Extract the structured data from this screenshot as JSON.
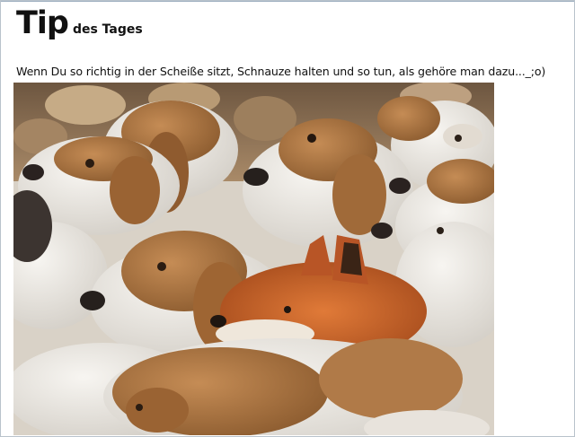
{
  "tip": {
    "title_big": "Tip",
    "title_small": "des Tages",
    "caption": "Wenn Du so richtig in der Scheiße sitzt, Schnauze halten und so tun, als gehöre man dazu..._;o)"
  },
  "photo": {
    "colors": {
      "wood": "#8b6a4a",
      "hound_tan": "#b47a45",
      "hound_white": "#ece8e2",
      "fox_orange": "#c9622a",
      "fox_dark": "#2a1a10"
    }
  }
}
